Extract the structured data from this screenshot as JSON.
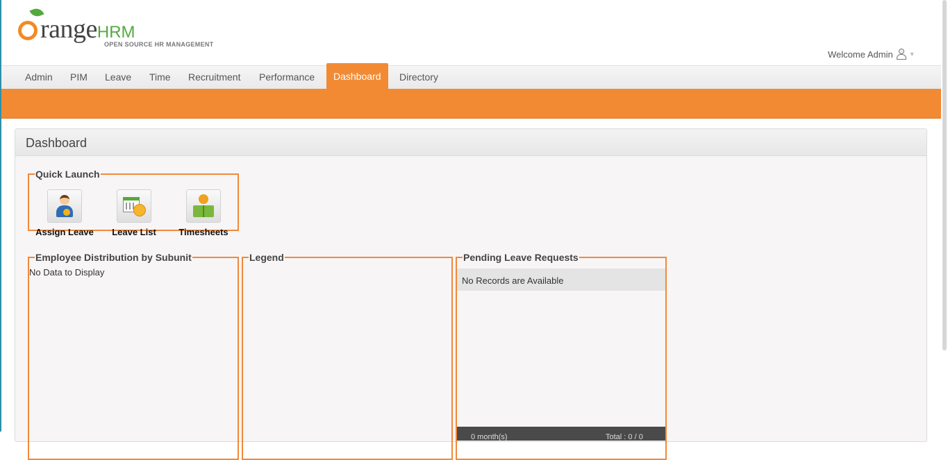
{
  "header": {
    "logo_main": "range",
    "logo_hrm": "HRM",
    "logo_tagline": "OPEN SOURCE HR MANAGEMENT",
    "welcome": "Welcome Admin"
  },
  "menu": {
    "items": [
      {
        "label": "Admin"
      },
      {
        "label": "PIM"
      },
      {
        "label": "Leave"
      },
      {
        "label": "Time"
      },
      {
        "label": "Recruitment"
      },
      {
        "label": "Performance"
      },
      {
        "label": "Dashboard",
        "active": true
      },
      {
        "label": "Directory"
      }
    ]
  },
  "colors": {
    "accent": "#f28a33",
    "brand_green": "#53a93f"
  },
  "dashboard": {
    "title": "Dashboard",
    "quick_launch": {
      "title": "Quick Launch",
      "items": [
        {
          "label": "Assign Leave",
          "icon": "assign-leave-icon"
        },
        {
          "label": "Leave List",
          "icon": "leave-list-icon"
        },
        {
          "label": "Timesheets",
          "icon": "timesheets-icon"
        }
      ]
    },
    "employee_distribution": {
      "title": "Employee Distribution by Subunit",
      "message": "No Data to Display"
    },
    "legend": {
      "title": "Legend"
    },
    "pending_leave": {
      "title": "Pending Leave Requests",
      "message": "No Records are Available",
      "footer_left": "0 month(s)",
      "footer_right": "Total : 0 / 0"
    }
  }
}
